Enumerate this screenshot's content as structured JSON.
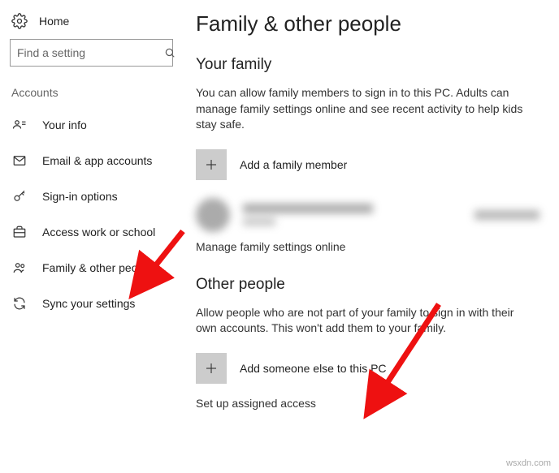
{
  "sidebar": {
    "home_label": "Home",
    "search_placeholder": "Find a setting",
    "section_heading": "Accounts",
    "items": [
      {
        "label": "Your info"
      },
      {
        "label": "Email & app accounts"
      },
      {
        "label": "Sign-in options"
      },
      {
        "label": "Access work or school"
      },
      {
        "label": "Family & other people"
      },
      {
        "label": "Sync your settings"
      }
    ]
  },
  "main": {
    "page_title": "Family & other people",
    "family": {
      "title": "Your family",
      "description": "You can allow family members to sign in to this PC. Adults can manage family settings online and see recent activity to help kids stay safe.",
      "add_label": "Add a family member",
      "manage_link": "Manage family settings online"
    },
    "other": {
      "title": "Other people",
      "description": "Allow people who are not part of your family to sign in with their own accounts. This won't add them to your family.",
      "add_label": "Add someone else to this PC",
      "setup_link": "Set up assigned access"
    }
  },
  "watermark": "wsxdn.com"
}
